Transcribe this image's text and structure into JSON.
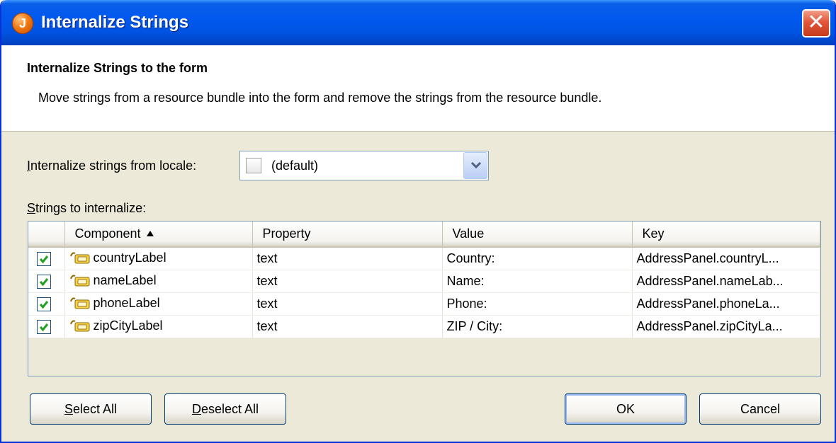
{
  "window": {
    "title": "Internalize Strings",
    "app_icon_letter": "J",
    "close_glyph": "✕"
  },
  "header": {
    "title": "Internalize Strings to the form",
    "description": "Move strings from a resource bundle into the form and remove the strings from the resource bundle."
  },
  "locale": {
    "label_mnemonic": "I",
    "label_rest": "nternalize strings from locale:",
    "value": "(default)"
  },
  "strings_label": {
    "mnemonic": "S",
    "rest": "trings to internalize:"
  },
  "table": {
    "columns": [
      "",
      "Component",
      "Property",
      "Value",
      "Key"
    ],
    "sorted_column": "Component",
    "sort_icon": "sort-ascending-icon",
    "rows": [
      {
        "checked": true,
        "component": "countryLabel",
        "property": "text",
        "value": "Country:",
        "key": "AddressPanel.countryL..."
      },
      {
        "checked": true,
        "component": "nameLabel",
        "property": "text",
        "value": "Name:",
        "key": "AddressPanel.nameLab..."
      },
      {
        "checked": true,
        "component": "phoneLabel",
        "property": "text",
        "value": "Phone:",
        "key": "AddressPanel.phoneLa..."
      },
      {
        "checked": true,
        "component": "zipCityLabel",
        "property": "text",
        "value": "ZIP / City:",
        "key": "AddressPanel.zipCityLa..."
      }
    ]
  },
  "buttons": {
    "select_all_mnemonic": "S",
    "select_all_rest": "elect All",
    "deselect_all_mnemonic": "D",
    "deselect_all_rest": "eselect All",
    "ok": "OK",
    "cancel": "Cancel"
  },
  "colors": {
    "titlebar": "#0054e3",
    "dialog_bg": "#ece9d8",
    "checkbox_check": "#21a121"
  }
}
